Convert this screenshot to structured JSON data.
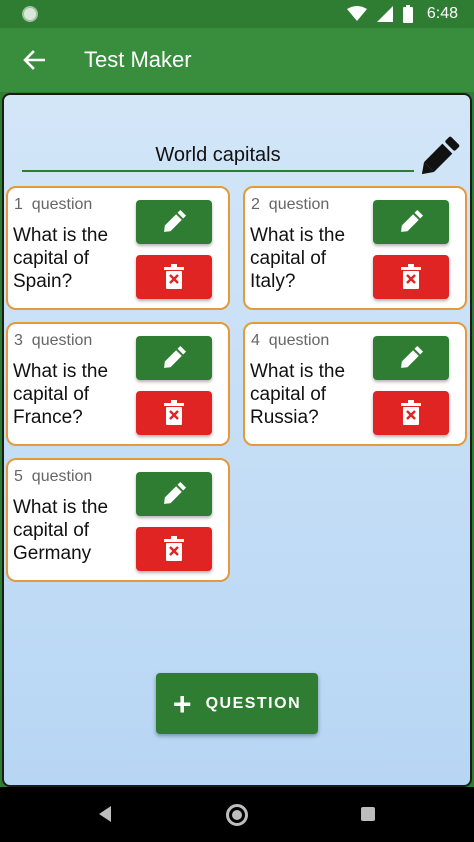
{
  "status": {
    "time": "6:48"
  },
  "app": {
    "title": "Test Maker"
  },
  "test_name": "World capitals",
  "question_label": "question",
  "questions": [
    {
      "number": "1",
      "text": "What is the capital of Spain?"
    },
    {
      "number": "2",
      "text": "What is the capital of Italy?"
    },
    {
      "number": "3",
      "text": "What is the capital of France?"
    },
    {
      "number": "4",
      "text": "What is the capital of Russia?"
    },
    {
      "number": "5",
      "text": "What is the capital of Germany"
    }
  ],
  "add_button": {
    "label": "QUESTION",
    "icon": "plus-icon"
  },
  "colors": {
    "primary": "#2e7d32",
    "appbar": "#388e3c",
    "delete": "#e02424",
    "card_border": "#e39a3a"
  }
}
